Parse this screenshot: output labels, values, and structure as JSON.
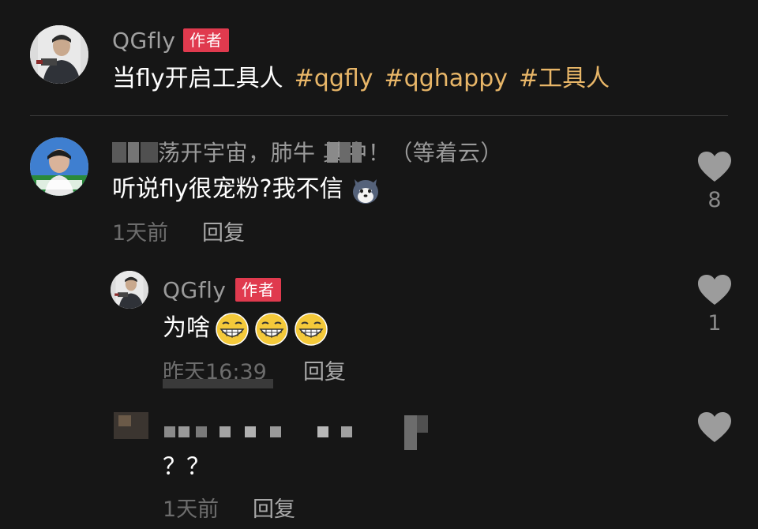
{
  "post": {
    "author_name": "QGfly",
    "author_badge": "作者",
    "caption_text": "当fly开启工具人",
    "hashtags": [
      "#qgfly",
      "#qghappy",
      "#工具人"
    ]
  },
  "comments": [
    {
      "username_visible": "荡开宇宙，肺牛  其中！（等着云）",
      "text": "听说fly很宠粉?我不信",
      "emoji": "husky-emoji",
      "time": "1天前",
      "reply_label": "回复",
      "likes": "8",
      "replies": [
        {
          "username": "QGfly",
          "badge": "作者",
          "text": "为啥",
          "emojis": [
            "grin-emoji",
            "grin-emoji",
            "grin-emoji"
          ],
          "time": "昨天16:39",
          "reply_label": "回复",
          "likes": "1"
        },
        {
          "username": "",
          "text": "？？",
          "time": "1天前",
          "reply_label": "回复",
          "likes": ""
        }
      ]
    }
  ],
  "colors": {
    "background": "#161616",
    "hashtag": "#e8b668",
    "badge": "#e03a4e",
    "username": "#9a9a9a",
    "meta": "#6d6d6d"
  }
}
